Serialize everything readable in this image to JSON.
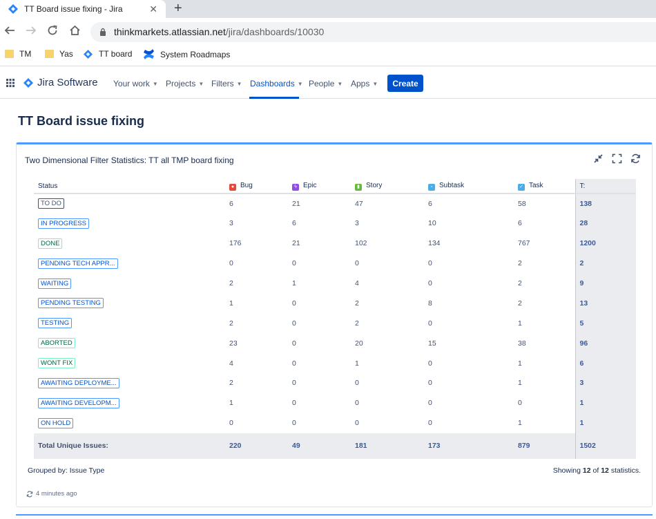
{
  "browser": {
    "tab_title": "TT Board issue fixing - Jira",
    "url_host": "thinkmarkets.atlassian.net",
    "url_path": "/jira/dashboards/10030",
    "bookmarks": [
      "TM",
      "Yas",
      "TT board",
      "System Roadmaps"
    ]
  },
  "nav": {
    "product": "Jira Software",
    "items": [
      "Your work",
      "Projects",
      "Filters",
      "Dashboards",
      "People",
      "Apps"
    ],
    "active": "Dashboards",
    "create_label": "Create"
  },
  "page": {
    "title": "TT Board issue fixing"
  },
  "gadget": {
    "title": "Two Dimensional Filter Statistics: TT all TMP board fixing",
    "columns": [
      "Status",
      "Bug",
      "Epic",
      "Story",
      "Subtask",
      "Task",
      "T:"
    ],
    "column_icon_colors": {
      "Bug": "#e5493a",
      "Epic": "#904ee2",
      "Story": "#63ba3c",
      "Subtask": "#4bade8",
      "Task": "#4bade8"
    },
    "rows": [
      {
        "status": "TO DO",
        "category": "default",
        "values": [
          "6",
          "21",
          "47",
          "6",
          "58"
        ],
        "total": "138"
      },
      {
        "status": "IN PROGRESS",
        "category": "inprogress",
        "values": [
          "3",
          "6",
          "3",
          "10",
          "6"
        ],
        "total": "28"
      },
      {
        "status": "DONE",
        "category": "success",
        "values": [
          "176",
          "21",
          "102",
          "134",
          "767"
        ],
        "total": "1200"
      },
      {
        "status": "PENDING TECH APPR...",
        "category": "inprogress",
        "values": [
          "0",
          "0",
          "0",
          "0",
          "2"
        ],
        "total": "2"
      },
      {
        "status": "WAITING",
        "category": "inprogress",
        "values": [
          "2",
          "1",
          "4",
          "0",
          "2"
        ],
        "total": "9"
      },
      {
        "status": "PENDING TESTING",
        "category": "inprogress",
        "values": [
          "1",
          "0",
          "2",
          "8",
          "2"
        ],
        "total": "13"
      },
      {
        "status": "TESTING",
        "category": "inprogress",
        "values": [
          "2",
          "0",
          "2",
          "0",
          "1"
        ],
        "total": "5"
      },
      {
        "status": "ABORTED",
        "category": "success",
        "values": [
          "23",
          "0",
          "20",
          "15",
          "38"
        ],
        "total": "96"
      },
      {
        "status": "WONT FIX",
        "category": "success",
        "values": [
          "4",
          "0",
          "1",
          "0",
          "1"
        ],
        "total": "6"
      },
      {
        "status": "AWAITING DEPLOYME...",
        "category": "inprogress",
        "values": [
          "2",
          "0",
          "0",
          "0",
          "1"
        ],
        "total": "3"
      },
      {
        "status": "AWAITING DEVELOPM...",
        "category": "inprogress",
        "values": [
          "1",
          "0",
          "0",
          "0",
          "0"
        ],
        "total": "1"
      },
      {
        "status": "ON HOLD",
        "category": "inprogress",
        "values": [
          "0",
          "0",
          "0",
          "0",
          "1"
        ],
        "total": "1"
      }
    ],
    "footer": {
      "label": "Total Unique Issues:",
      "values": [
        "220",
        "49",
        "181",
        "173",
        "879"
      ],
      "total": "1502"
    },
    "grouped_by": "Grouped by: Issue Type",
    "showing_prefix": "Showing",
    "showing_count": "12",
    "showing_of": "of",
    "showing_total": "12",
    "showing_suffix": "statistics.",
    "updated": "4 minutes ago"
  },
  "colors": {
    "accent": "#0052cc",
    "gadget_border": "#4c9aff"
  }
}
